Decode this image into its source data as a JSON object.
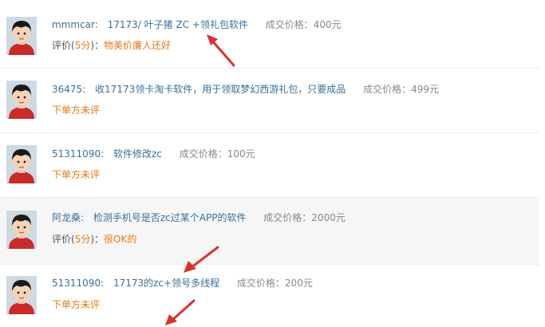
{
  "reviews": [
    {
      "user": "mmmcar:",
      "title": "17173/ 叶子猪 ZC +领礼包软件",
      "price": "成交价格：400元",
      "rating_label": "评价(",
      "rating_value": "5分",
      "rating_close": ")：",
      "comment": "物美价廉人还好"
    },
    {
      "user": "36475:",
      "title": "收17173领卡淘卡软件，用于领取梦幻西游礼包，只要成品",
      "price": "成交价格：499元",
      "status": "下单方未评"
    },
    {
      "user": "51311090:",
      "title": "软件修改zc",
      "price": "成交价格：100元",
      "status": "下单方未评"
    },
    {
      "user": "阿龙桑:",
      "title": "检测手机号是否zc过某个APP的软件",
      "price": "成交价格：2000元",
      "rating_label": "评价(",
      "rating_value": "5分",
      "rating_close": ")：",
      "comment": "很OK的"
    },
    {
      "user": "51311090:",
      "title": "17173的zc+领号多线程",
      "price": "成交价格：200元",
      "status": "下单方未评"
    }
  ],
  "colors": {
    "link": "#3b6e98",
    "accent": "#e47a16",
    "price": "#888888",
    "arrow": "#d9332b"
  },
  "icons": [
    "avatar-icon",
    "annotation-arrow-icon"
  ]
}
